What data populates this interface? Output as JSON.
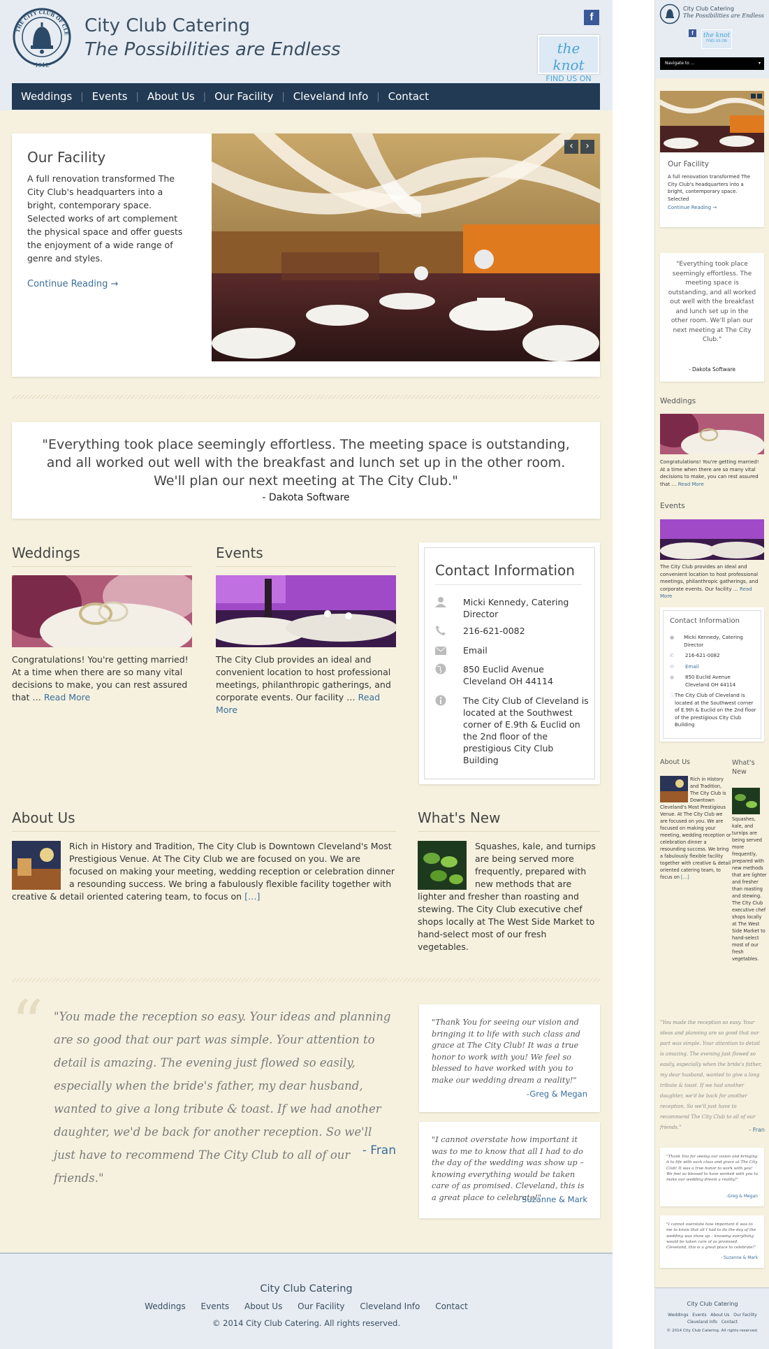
{
  "site": {
    "title": "City Club Catering",
    "tagline": "The Possibilities are Endless",
    "logo_text": "THE CITY CLUB OF CLEVELAND",
    "logo_year": "·1912·"
  },
  "social": {
    "facebook": "f",
    "knot_line1": "the knot",
    "knot_line2": "FIND US ON"
  },
  "nav": [
    {
      "label": "Weddings"
    },
    {
      "label": "Events"
    },
    {
      "label": "About Us"
    },
    {
      "label": "Our Facility"
    },
    {
      "label": "Cleveland Info"
    },
    {
      "label": "Contact"
    }
  ],
  "facility": {
    "title": "Our Facility",
    "body": "A full renovation transformed The City Club's headquarters into a bright, contemporary space. Selected works of art complement the physical space and offer guests the enjoyment of a wide range of genre and styles.",
    "mobile_body": "A full renovation transformed The City Club's headquarters into a bright, contemporary space. Selected",
    "link": "Continue Reading →",
    "prev": "‹",
    "next": "›"
  },
  "featured_quote": {
    "text": "\"Everything took place seemingly effortless. The meeting space is outstanding, and all worked out well with the breakfast and lunch set up in the other room. We'll plan our next meeting at The City Club.\"",
    "author": "- Dakota Software"
  },
  "weddings": {
    "title": "Weddings",
    "text": "Congratulations! You're getting married! At a time when there are so many vital decisions to make, you can rest assured that …",
    "link": "Read More"
  },
  "events": {
    "title": "Events",
    "text": "The City Club provides an ideal and convenient location to host professional meetings, philanthropic gatherings, and corporate events. Our facility …",
    "link": "Read More"
  },
  "contact": {
    "title": "Contact Information",
    "name": "Micki Kennedy, Catering Director",
    "phone": "216-621-0082",
    "email": "Email",
    "address1": "850 Euclid Avenue",
    "address2": "Cleveland OH 44114",
    "info": "The City Club of Cleveland is located at the Southwest corner of E.9th & Euclid on the 2nd floor of the prestigious City Club Building"
  },
  "about": {
    "title": "About Us",
    "text": "Rich in History and Tradition, The City Club is Downtown Cleveland's Most Prestigious Venue. At The City Club we are focused on you.   We are focused on making your meeting, wedding reception or celebration dinner  a resounding success. We bring a fabulously flexible facility together with creative & detail oriented catering team, to focus on",
    "more": "[…]"
  },
  "whats_new": {
    "title": "What's New",
    "text": "Squashes, kale, and turnips are being served more frequently, prepared with new methods that are lighter and fresher than roasting and stewing. The City Club executive chef shops locally at The West Side Market to hand-select most of our fresh vegetables."
  },
  "testimonials": {
    "main": {
      "mark": "“",
      "text": "\"You made the reception so easy. Your ideas and planning are so good that our part was simple. Your attention to detail is amazing. The evening just flowed so easily, especially when the bride's father, my dear husband, wanted to give a long tribute & toast. If we had another daughter, we'd be back for another reception. So we'll just have to recommend The City Club to all of our friends.\"",
      "author": "- Fran"
    },
    "t1": {
      "text": "\"Thank You for seeing our vision and bringing it to life with such class and grace at The City Club! It was a true honor to work with you! We feel so blessed to have worked with you to make our wedding dream a reality!\"",
      "author": "-Greg & Megan"
    },
    "t2": {
      "text": "\"I cannot overstate how important it was to me to know that all I had to do the day of the wedding was show up – knowing everything would be taken care of as promised. Cleveland, this is a great place to celebrate!\"",
      "author": "- Suzanne & Mark"
    }
  },
  "footer": {
    "title": "City Club Catering",
    "links": [
      "Weddings",
      "Events",
      "About Us",
      "Our Facility",
      "Cleveland Info",
      "Contact"
    ],
    "copyright": "© 2014 City Club Catering. All rights reserved."
  },
  "mobile": {
    "nav_select": "Navigate to ...",
    "nav_caret": "▾",
    "weddings_text": "Congratulations! You're getting married! At a time when there are so many vital decisions to make, you can rest assured that …",
    "events_text": "The City Club provides an ideal and convenient location to host professional meetings, philanthropic gatherings, and corporate events. Our facility …",
    "about_text": "Rich in History and Tradition, The City Club is Downtown Cleveland's Most Prestigious Venue. At The City Club we are focused on you.  We are focused on making your meeting, wedding reception or celebration dinner a resounding success. We bring a fabulously flexible facility together with creative & detail oriented catering team, to focus on",
    "whats_new_title": "What's New"
  }
}
